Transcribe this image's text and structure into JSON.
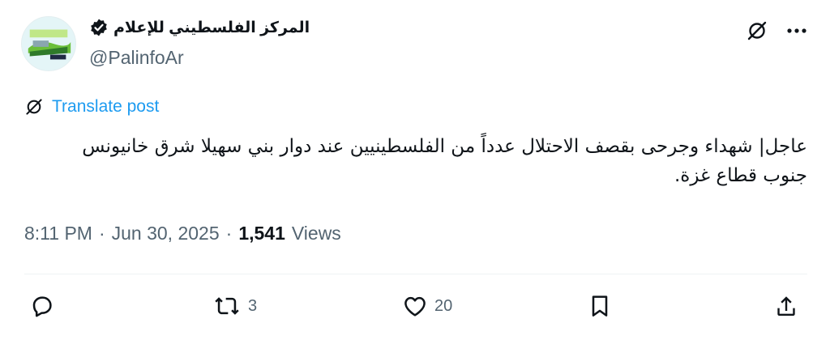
{
  "author": {
    "display_name": "المركز الفلسطيني للإعلام",
    "handle": "@PalinfoAr",
    "verified": true,
    "avatar_icon": "palinfo-logo-avatar"
  },
  "header_icons": [
    "grok-icon",
    "more-icon"
  ],
  "translate": {
    "label": "Translate post",
    "icon": "grok-icon"
  },
  "post": {
    "text": "عاجل| شهداء وجرحى بقصف الاحتلال عدداً من الفلسطينيين عند دوار بني سهيلا شرق خانيونس جنوب قطاع غزة."
  },
  "meta": {
    "time": "8:11 PM",
    "separator": "·",
    "date": "Jun 30, 2025",
    "views_count": "1,541",
    "views_label": "Views"
  },
  "actions": {
    "reply": {
      "icon": "reply-icon",
      "count": ""
    },
    "repost": {
      "icon": "repost-icon",
      "count": "3"
    },
    "like": {
      "icon": "heart-icon",
      "count": "20"
    },
    "bookmark": {
      "icon": "bookmark-icon",
      "count": ""
    },
    "share": {
      "icon": "share-icon",
      "count": ""
    }
  },
  "colors": {
    "accent": "#1d9bf0",
    "text_primary": "#0f1419",
    "text_secondary": "#536471",
    "divider": "#eff3f4"
  }
}
